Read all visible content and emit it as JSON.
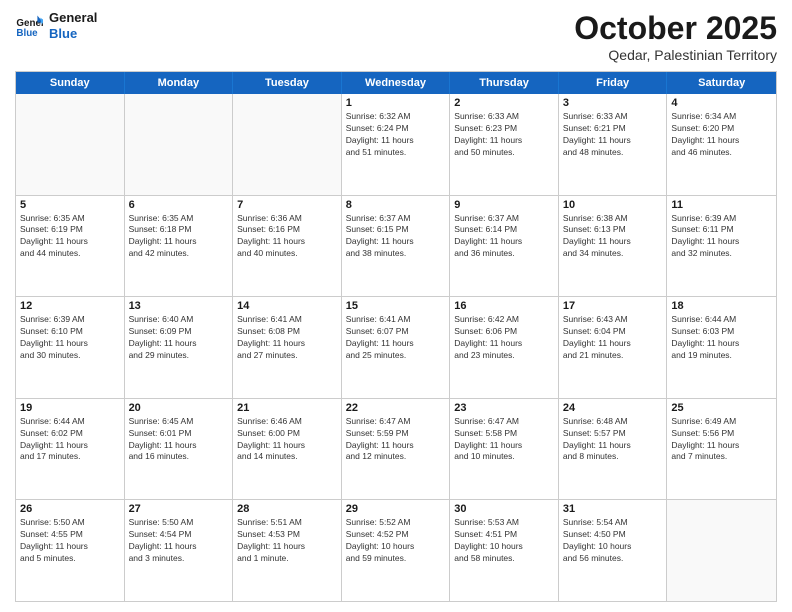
{
  "header": {
    "logo_line1": "General",
    "logo_line2": "Blue",
    "month": "October 2025",
    "location": "Qedar, Palestinian Territory"
  },
  "weekdays": [
    "Sunday",
    "Monday",
    "Tuesday",
    "Wednesday",
    "Thursday",
    "Friday",
    "Saturday"
  ],
  "weeks": [
    [
      {
        "day": "",
        "info": ""
      },
      {
        "day": "",
        "info": ""
      },
      {
        "day": "",
        "info": ""
      },
      {
        "day": "1",
        "info": "Sunrise: 6:32 AM\nSunset: 6:24 PM\nDaylight: 11 hours\nand 51 minutes."
      },
      {
        "day": "2",
        "info": "Sunrise: 6:33 AM\nSunset: 6:23 PM\nDaylight: 11 hours\nand 50 minutes."
      },
      {
        "day": "3",
        "info": "Sunrise: 6:33 AM\nSunset: 6:21 PM\nDaylight: 11 hours\nand 48 minutes."
      },
      {
        "day": "4",
        "info": "Sunrise: 6:34 AM\nSunset: 6:20 PM\nDaylight: 11 hours\nand 46 minutes."
      }
    ],
    [
      {
        "day": "5",
        "info": "Sunrise: 6:35 AM\nSunset: 6:19 PM\nDaylight: 11 hours\nand 44 minutes."
      },
      {
        "day": "6",
        "info": "Sunrise: 6:35 AM\nSunset: 6:18 PM\nDaylight: 11 hours\nand 42 minutes."
      },
      {
        "day": "7",
        "info": "Sunrise: 6:36 AM\nSunset: 6:16 PM\nDaylight: 11 hours\nand 40 minutes."
      },
      {
        "day": "8",
        "info": "Sunrise: 6:37 AM\nSunset: 6:15 PM\nDaylight: 11 hours\nand 38 minutes."
      },
      {
        "day": "9",
        "info": "Sunrise: 6:37 AM\nSunset: 6:14 PM\nDaylight: 11 hours\nand 36 minutes."
      },
      {
        "day": "10",
        "info": "Sunrise: 6:38 AM\nSunset: 6:13 PM\nDaylight: 11 hours\nand 34 minutes."
      },
      {
        "day": "11",
        "info": "Sunrise: 6:39 AM\nSunset: 6:11 PM\nDaylight: 11 hours\nand 32 minutes."
      }
    ],
    [
      {
        "day": "12",
        "info": "Sunrise: 6:39 AM\nSunset: 6:10 PM\nDaylight: 11 hours\nand 30 minutes."
      },
      {
        "day": "13",
        "info": "Sunrise: 6:40 AM\nSunset: 6:09 PM\nDaylight: 11 hours\nand 29 minutes."
      },
      {
        "day": "14",
        "info": "Sunrise: 6:41 AM\nSunset: 6:08 PM\nDaylight: 11 hours\nand 27 minutes."
      },
      {
        "day": "15",
        "info": "Sunrise: 6:41 AM\nSunset: 6:07 PM\nDaylight: 11 hours\nand 25 minutes."
      },
      {
        "day": "16",
        "info": "Sunrise: 6:42 AM\nSunset: 6:06 PM\nDaylight: 11 hours\nand 23 minutes."
      },
      {
        "day": "17",
        "info": "Sunrise: 6:43 AM\nSunset: 6:04 PM\nDaylight: 11 hours\nand 21 minutes."
      },
      {
        "day": "18",
        "info": "Sunrise: 6:44 AM\nSunset: 6:03 PM\nDaylight: 11 hours\nand 19 minutes."
      }
    ],
    [
      {
        "day": "19",
        "info": "Sunrise: 6:44 AM\nSunset: 6:02 PM\nDaylight: 11 hours\nand 17 minutes."
      },
      {
        "day": "20",
        "info": "Sunrise: 6:45 AM\nSunset: 6:01 PM\nDaylight: 11 hours\nand 16 minutes."
      },
      {
        "day": "21",
        "info": "Sunrise: 6:46 AM\nSunset: 6:00 PM\nDaylight: 11 hours\nand 14 minutes."
      },
      {
        "day": "22",
        "info": "Sunrise: 6:47 AM\nSunset: 5:59 PM\nDaylight: 11 hours\nand 12 minutes."
      },
      {
        "day": "23",
        "info": "Sunrise: 6:47 AM\nSunset: 5:58 PM\nDaylight: 11 hours\nand 10 minutes."
      },
      {
        "day": "24",
        "info": "Sunrise: 6:48 AM\nSunset: 5:57 PM\nDaylight: 11 hours\nand 8 minutes."
      },
      {
        "day": "25",
        "info": "Sunrise: 6:49 AM\nSunset: 5:56 PM\nDaylight: 11 hours\nand 7 minutes."
      }
    ],
    [
      {
        "day": "26",
        "info": "Sunrise: 5:50 AM\nSunset: 4:55 PM\nDaylight: 11 hours\nand 5 minutes."
      },
      {
        "day": "27",
        "info": "Sunrise: 5:50 AM\nSunset: 4:54 PM\nDaylight: 11 hours\nand 3 minutes."
      },
      {
        "day": "28",
        "info": "Sunrise: 5:51 AM\nSunset: 4:53 PM\nDaylight: 11 hours\nand 1 minute."
      },
      {
        "day": "29",
        "info": "Sunrise: 5:52 AM\nSunset: 4:52 PM\nDaylight: 10 hours\nand 59 minutes."
      },
      {
        "day": "30",
        "info": "Sunrise: 5:53 AM\nSunset: 4:51 PM\nDaylight: 10 hours\nand 58 minutes."
      },
      {
        "day": "31",
        "info": "Sunrise: 5:54 AM\nSunset: 4:50 PM\nDaylight: 10 hours\nand 56 minutes."
      },
      {
        "day": "",
        "info": ""
      }
    ]
  ]
}
